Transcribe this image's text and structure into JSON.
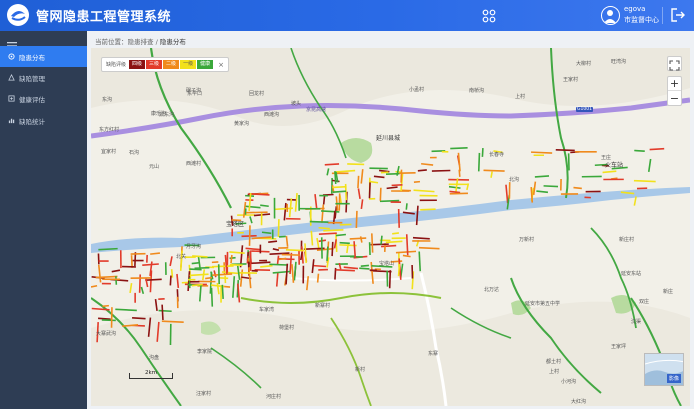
{
  "header": {
    "title": "管网隐患工程管理系统",
    "user_name": "egova",
    "user_role": "市监督中心",
    "brand_color": "#2a6ae6"
  },
  "sidebar": {
    "items": [
      {
        "label": "隐患分布",
        "icon": "map-marker-icon",
        "active": true
      },
      {
        "label": "缺陷管理",
        "icon": "defect-icon",
        "active": false
      },
      {
        "label": "健康评估",
        "icon": "health-icon",
        "active": false
      },
      {
        "label": "缺陷统计",
        "icon": "stats-icon",
        "active": false
      }
    ]
  },
  "breadcrumb": {
    "prefix": "当前位置：",
    "parent": "隐患排查",
    "separator": " / ",
    "current": "隐患分布"
  },
  "legend": {
    "title": "缺陷评级",
    "levels": [
      {
        "label": "四级",
        "color": "#8b1212"
      },
      {
        "label": "三级",
        "color": "#e23b2a"
      },
      {
        "label": "二级",
        "color": "#f08a1c"
      },
      {
        "label": "一级",
        "color": "#f2e11b"
      },
      {
        "label": "健康",
        "color": "#3aa83a"
      }
    ],
    "close": "×"
  },
  "map": {
    "scale_label": "2km",
    "thumb_label": "影像",
    "zoom_in": "+",
    "zoom_out": "−",
    "highway_label": "京昆高速",
    "shield": "G1001",
    "places": [
      {
        "name": "宜家村",
        "cls": ""
      },
      {
        "name": "碾子沟",
        "cls": ""
      },
      {
        "name": "鼎东沟",
        "cls": ""
      },
      {
        "name": "东平口",
        "cls": ""
      },
      {
        "name": "东沟",
        "cls": ""
      },
      {
        "name": "大柳村",
        "cls": ""
      },
      {
        "name": "南桥沟",
        "cls": ""
      },
      {
        "name": "王家村",
        "cls": ""
      },
      {
        "name": "上村",
        "cls": ""
      },
      {
        "name": "小孟村",
        "cls": ""
      },
      {
        "name": "回龙村",
        "cls": ""
      },
      {
        "name": "康乐沟",
        "cls": ""
      },
      {
        "name": "西滩沟",
        "cls": ""
      },
      {
        "name": "坡头",
        "cls": ""
      },
      {
        "name": "石沟",
        "cls": ""
      },
      {
        "name": "西滩村",
        "cls": ""
      },
      {
        "name": "元山",
        "cls": ""
      },
      {
        "name": "长春寺",
        "cls": ""
      },
      {
        "name": "王庄",
        "cls": ""
      },
      {
        "name": "旺湾沟",
        "cls": ""
      },
      {
        "name": "黄家沟",
        "cls": ""
      },
      {
        "name": "东方红村",
        "cls": ""
      },
      {
        "name": "火车站",
        "cls": "big"
      },
      {
        "name": "延川县城",
        "cls": "big"
      },
      {
        "name": "宝塔区",
        "cls": "big"
      },
      {
        "name": "万新村",
        "cls": ""
      },
      {
        "name": "新庄村",
        "cls": ""
      },
      {
        "name": "北沟",
        "cls": ""
      },
      {
        "name": "月牙沟",
        "cls": ""
      },
      {
        "name": "北关",
        "cls": ""
      },
      {
        "name": "宝塔山",
        "cls": ""
      },
      {
        "name": "延安东站",
        "cls": ""
      },
      {
        "name": "北万达",
        "cls": ""
      },
      {
        "name": "延安市第五中学",
        "cls": ""
      },
      {
        "name": "新庄",
        "cls": ""
      },
      {
        "name": "东寨",
        "cls": ""
      },
      {
        "name": "王家坪",
        "cls": ""
      },
      {
        "name": "大寨武沟",
        "cls": ""
      },
      {
        "name": "沟盘",
        "cls": ""
      },
      {
        "name": "李家院",
        "cls": ""
      },
      {
        "name": "荷堡村",
        "cls": ""
      },
      {
        "name": "新村",
        "cls": ""
      },
      {
        "name": "车家湾",
        "cls": ""
      },
      {
        "name": "新寨村",
        "cls": ""
      },
      {
        "name": "上村",
        "cls": ""
      },
      {
        "name": "小河沟",
        "cls": ""
      },
      {
        "name": "都土村",
        "cls": ""
      },
      {
        "name": "大红沟",
        "cls": ""
      },
      {
        "name": "汪家村",
        "cls": ""
      },
      {
        "name": "河庄村",
        "cls": ""
      },
      {
        "name": "双庄",
        "cls": ""
      },
      {
        "name": "沈渠",
        "cls": ""
      }
    ]
  },
  "colors": {
    "sidebar_bg": "#2e3d54",
    "active": "#2f7cf0",
    "river": "#a8c8e8",
    "highway": "#a98fe0"
  }
}
